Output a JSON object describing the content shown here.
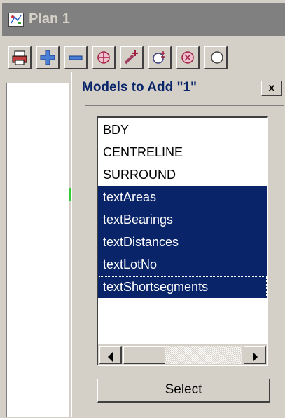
{
  "plan_window": {
    "title": "Plan 1",
    "icon": "plan-window-icon",
    "toolbar": [
      {
        "name": "print-icon"
      },
      {
        "name": "pan-plus-icon"
      },
      {
        "name": "zoom-out-icon"
      },
      {
        "name": "zoom-target-icon"
      },
      {
        "name": "add-model-icon"
      },
      {
        "name": "zoom-plus-minus-icon"
      },
      {
        "name": "zoom-extent-icon"
      },
      {
        "name": "more-icon"
      }
    ]
  },
  "dialog": {
    "title": "Models to Add \"1\"",
    "close_label": "x",
    "models": [
      {
        "label": "BDY",
        "selected": false
      },
      {
        "label": "CENTRELINE",
        "selected": false
      },
      {
        "label": "SURROUND",
        "selected": false
      },
      {
        "label": "textAreas",
        "selected": true
      },
      {
        "label": "textBearings",
        "selected": true
      },
      {
        "label": "textDistances",
        "selected": true
      },
      {
        "label": "textLotNo",
        "selected": true
      },
      {
        "label": "textShortsegments",
        "selected": true,
        "focused": true
      }
    ],
    "select_button": "Select"
  },
  "colors": {
    "face": "#d4d0c8",
    "selection": "#0a246a",
    "title_inactive": "#808080",
    "canvas_mark": "#33cc33"
  }
}
